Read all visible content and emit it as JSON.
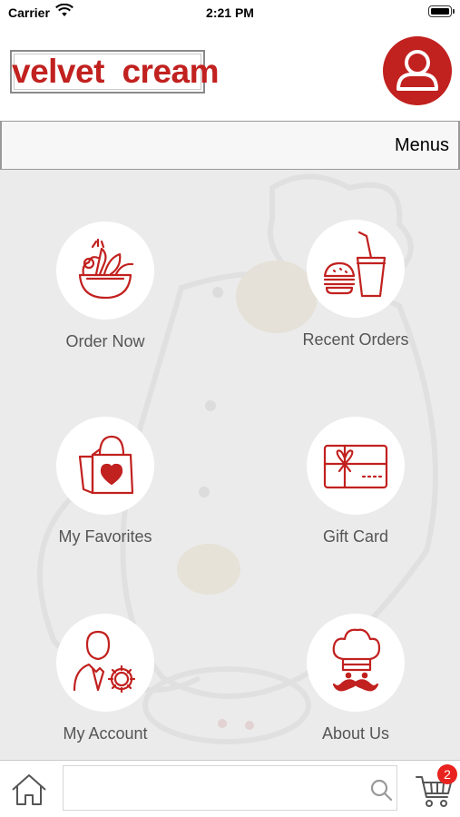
{
  "status_bar": {
    "carrier": "Carrier",
    "time": "2:21 PM"
  },
  "header": {
    "logo_text": "velvet  cream",
    "brand_color": "#c1211f",
    "profile_icon": "user-avatar-icon"
  },
  "menu_bar": {
    "title": "Menus"
  },
  "tiles": [
    {
      "label": "Order Now",
      "icon": "salad-bowl-icon"
    },
    {
      "label": "Recent Orders",
      "icon": "burger-drink-icon"
    },
    {
      "label": "My Favorites",
      "icon": "shopping-bag-heart-icon"
    },
    {
      "label": "Gift Card",
      "icon": "gift-card-icon"
    },
    {
      "label": "My Account",
      "icon": "user-settings-icon"
    },
    {
      "label": "About Us",
      "icon": "chef-icon"
    }
  ],
  "tab_bar": {
    "home_icon": "home-icon",
    "search_placeholder": "",
    "search_icon": "search-icon",
    "cart_icon": "cart-icon",
    "cart_count": "2"
  }
}
